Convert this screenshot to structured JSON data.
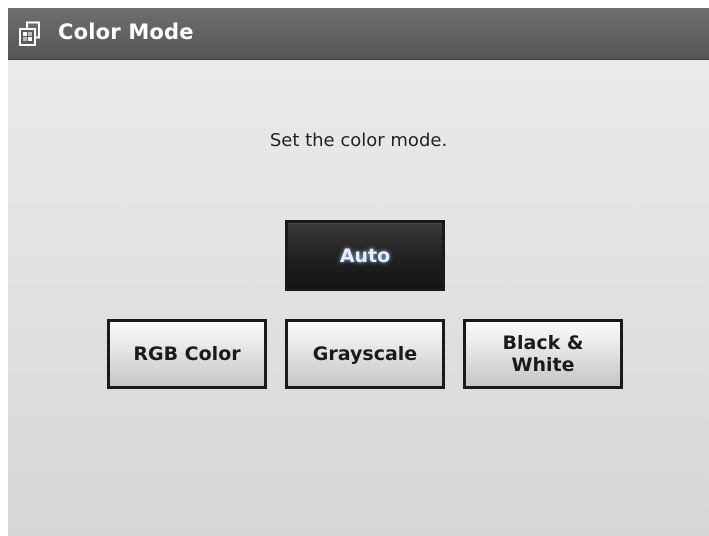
{
  "window": {
    "title": "Color Mode",
    "icon": "color-mode-icon"
  },
  "main": {
    "instruction": "Set the color mode."
  },
  "options": {
    "auto": {
      "label": "Auto",
      "selected": true
    },
    "rgb": {
      "label": "RGB Color",
      "selected": false
    },
    "grayscale": {
      "label": "Grayscale",
      "selected": false
    },
    "black_white": {
      "line1": "Black &",
      "line2": "White",
      "selected": false
    }
  },
  "colors": {
    "title_bar": "#5f5f5f",
    "selected_button": "#222222",
    "selected_text": "#dfefff",
    "button_border": "#1a1a1a"
  }
}
